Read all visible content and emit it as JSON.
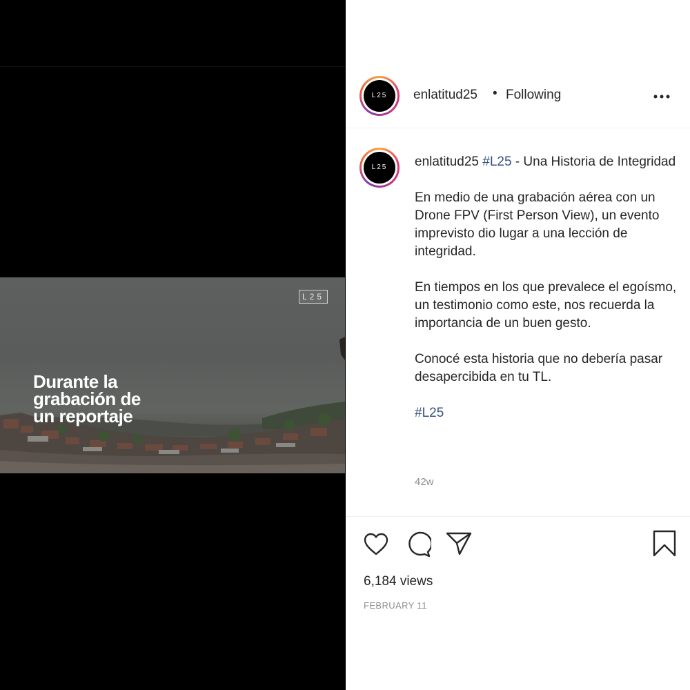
{
  "media": {
    "watermark": "L25",
    "overlay_lines": [
      "Durante la",
      "grabación de",
      "un reportaje"
    ]
  },
  "header": {
    "avatar_text": "L25",
    "username": "enlatitud25",
    "separator": "•",
    "follow_status": "Following",
    "more": "•••"
  },
  "caption": {
    "username": "enlatitud25",
    "hashtag1": "#L25",
    "title_rest": " - Una Historia de Integridad",
    "paragraph1": "En medio de una grabación aérea con un Drone FPV (First Person View), un evento imprevisto dio lugar a una lección de integridad.",
    "paragraph2": "En tiempos en los que prevalece el egoísmo, un testimonio como este, nos recuerda la importancia de un buen gesto.",
    "paragraph3": "Conocé esta historia que no debería pasar desapercibida en tu TL.",
    "hashtag2": "#L25",
    "time_ago": "42w"
  },
  "footer": {
    "views": "6,184 views",
    "date": "FEBRUARY 11"
  },
  "icons": [
    "heart-icon",
    "comment-icon",
    "share-icon",
    "bookmark-icon",
    "more-icon"
  ],
  "colors": {
    "hashtag": "#385185",
    "muted": "#8e8e8e",
    "text": "#262626"
  }
}
